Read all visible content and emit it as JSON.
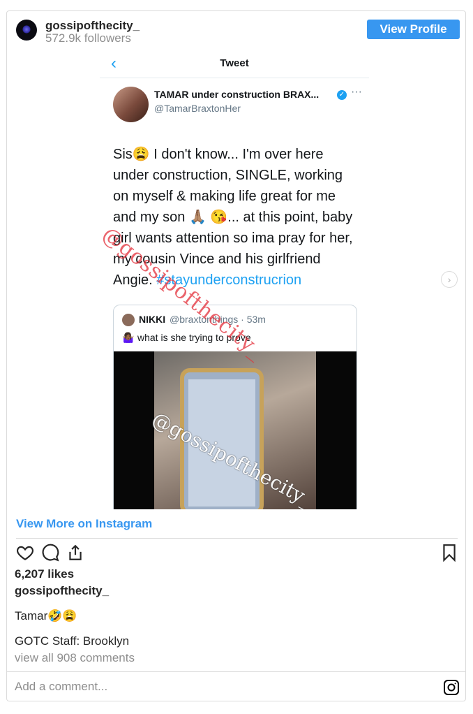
{
  "header": {
    "username": "gossipofthecity_",
    "followers": "572.9k followers",
    "view_profile_label": "View Profile"
  },
  "tweet": {
    "nav_title": "Tweet",
    "author_name": "TAMAR under construction BRAX...",
    "author_handle": "@TamarBraxtonHer",
    "text_lines": [
      "Sis😩 I don't know... I'm over here",
      "under construction, SINGLE, working",
      "on myself & making life great for me",
      "and my son 🙏🏽 😘... at this point, baby",
      "girl wants attention so ima pray for her,",
      "my cousin Vince and his girlfriend"
    ],
    "last_line_prefix": "Angie. ",
    "hashtag": "#stayunderconstrucrion",
    "quote": {
      "name": "NIKKI",
      "handle": "@braxtonthings · 53m",
      "emoji": "🤷🏾‍♀️",
      "text": "what is she trying to prove"
    },
    "watermark": "@gossipofthecity_",
    "video_watermark": "@gossipofthecity_"
  },
  "view_more_label": "View More on Instagram",
  "icons": {
    "like": "heart-icon",
    "comment": "comment-icon",
    "share": "share-icon",
    "save": "bookmark-icon",
    "instagram": "instagram-icon",
    "next": "chevron-right-icon"
  },
  "post": {
    "likes": "6,207 likes",
    "username": "gossipofthecity_",
    "caption": "Tamar🤣😩",
    "staff": "GOTC Staff: Brooklyn",
    "view_comments": "view all 908 comments",
    "comment_placeholder": "Add a comment..."
  },
  "colors": {
    "accent": "#3897f0",
    "twitter_blue": "#1da1f2",
    "watermark_red": "#e3303a",
    "muted": "#8e8e8e"
  }
}
